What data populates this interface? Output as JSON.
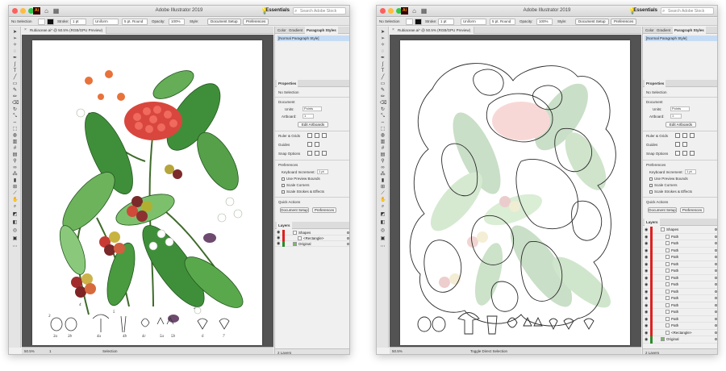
{
  "app": {
    "title": "Adobe Illustrator 2019",
    "workspace": "Essentials",
    "search_placeholder": "Search Adobe Stock"
  },
  "control_bar": {
    "selection": "No Selection",
    "stroke_label": "Stroke:",
    "stroke_value": "1 pt",
    "brush": "Uniform",
    "cap": "5 pt. Round",
    "opacity_label": "Opacity:",
    "opacity_value": "100%",
    "style_label": "Style:",
    "document_setup": "Document Setup",
    "preferences": "Preferences"
  },
  "left_window": {
    "doc_tab": "Rubiaceae.ai* @ 50.5% (RGB/GPU Preview)",
    "zoom": "50.5%",
    "page": "1",
    "status_tool": "Selection",
    "layers": [
      {
        "name": "Shapes"
      },
      {
        "name": "<Rectangle>"
      },
      {
        "name": "Original"
      }
    ],
    "layers_count": "2 Layers",
    "labels": [
      "3",
      "4",
      "2",
      "3a",
      "3b",
      "4a",
      "5",
      "4b",
      "4c",
      "5a",
      "5b",
      "6",
      "7"
    ]
  },
  "right_window": {
    "doc_tab": "Rubiaceae.ai* @ 50.5% (RGB/GPU Preview)",
    "zoom": "50.5%",
    "status_tool": "Toggle Direct Selection",
    "layers": [
      {
        "name": "Shapes"
      },
      {
        "name": "Path"
      },
      {
        "name": "Path"
      },
      {
        "name": "Path"
      },
      {
        "name": "Path"
      },
      {
        "name": "Path"
      },
      {
        "name": "Path"
      },
      {
        "name": "Path"
      },
      {
        "name": "Path"
      },
      {
        "name": "Path"
      },
      {
        "name": "Path"
      },
      {
        "name": "Path"
      },
      {
        "name": "Path"
      },
      {
        "name": "Path"
      },
      {
        "name": "Path"
      },
      {
        "name": "<Rectangle>"
      },
      {
        "name": "Original"
      }
    ],
    "layers_count": "2 Layers"
  },
  "panel": {
    "tabs": [
      "Color",
      "Gradient",
      "Paragraph Styles"
    ],
    "active_tab": "Paragraph Styles",
    "paragraph_style": "[Normal Paragraph Style]",
    "properties_tab": "Properties",
    "no_selection": "No Selection",
    "document_heading": "Document",
    "units_label": "Units:",
    "units_value": "Points",
    "artboard_label": "Artboard:",
    "artboard_value": "1",
    "edit_artboards": "Edit Artboards",
    "rulers_grids": "Ruler & Grids",
    "guides": "Guides",
    "snap_options": "Snap Options",
    "preferences_heading": "Preferences",
    "keyboard_increment_label": "Keyboard Increment:",
    "keyboard_increment_value": "1 pt",
    "use_preview_bounds": "Use Preview Bounds",
    "scale_corners": "Scale Corners",
    "scale_strokes": "Scale Strokes & Effects",
    "quick_actions": "Quick Actions",
    "document_setup": "Document Setup",
    "preferences": "Preferences",
    "layers_tab": "Layers"
  },
  "colors": {
    "accent_blue": "#c6dcf5",
    "layer_red": "#dd2222",
    "canvas_gray": "#535353",
    "panel_bg": "#f0f0f0"
  }
}
